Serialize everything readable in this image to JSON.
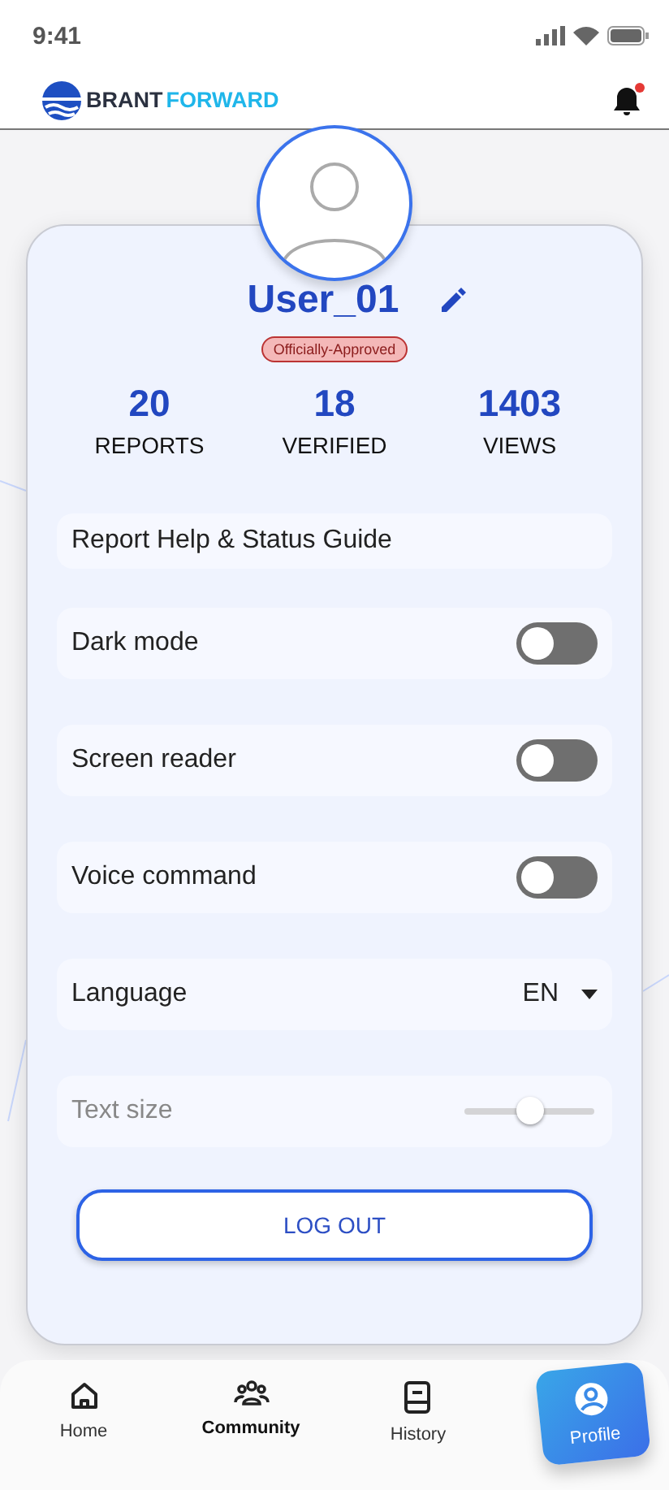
{
  "status_bar": {
    "time": "9:41"
  },
  "header": {
    "brand_first": "BRANT",
    "brand_second": "FORWARD",
    "notification": true
  },
  "profile": {
    "username": "User_01",
    "badge": "Officially-Approved",
    "stats": [
      {
        "value": "20",
        "label": "REPORTS"
      },
      {
        "value": "18",
        "label": "VERIFIED"
      },
      {
        "value": "1403",
        "label": "VIEWS"
      }
    ]
  },
  "settings": [
    {
      "kind": "link",
      "label": "Report Help & Status Guide",
      "disabled": false
    },
    {
      "kind": "toggle",
      "label": "Dark mode",
      "on": false,
      "disabled": false
    },
    {
      "kind": "toggle",
      "label": "Screen reader",
      "on": false,
      "disabled": false
    },
    {
      "kind": "toggle",
      "label": "Voice command",
      "on": false,
      "disabled": false
    },
    {
      "kind": "select",
      "label": "Language",
      "value": "EN",
      "disabled": false
    },
    {
      "kind": "slider",
      "label": "Text size",
      "level": 0.5,
      "disabled": true
    }
  ],
  "logout": "LOG OUT",
  "nav": [
    {
      "label": "Home",
      "kind": "home",
      "selected": false,
      "bold": false
    },
    {
      "label": "Community",
      "kind": "people",
      "selected": false,
      "bold": true
    },
    {
      "label": "History",
      "kind": "book",
      "selected": false,
      "bold": false
    },
    {
      "label": "Profile",
      "kind": "profile",
      "selected": true,
      "bold": false
    }
  ]
}
